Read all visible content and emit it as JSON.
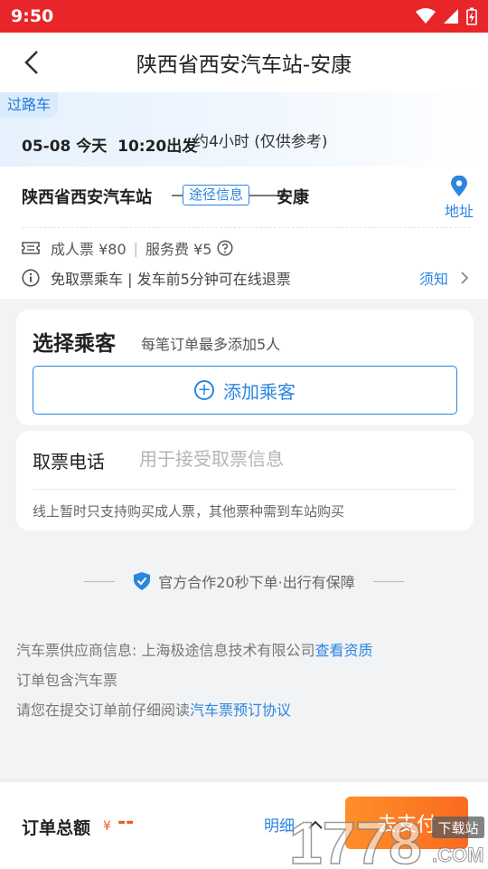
{
  "status_bar": {
    "time": "9:50"
  },
  "nav": {
    "title": "陕西省西安汽车站-安康"
  },
  "trip": {
    "tag": "过路车",
    "datetime": "05-08 今天  10:20出发",
    "duration": "约4小时 (仅供参考)",
    "from": "陕西省西安汽车站",
    "route_info": "途径信息",
    "to": "安康",
    "address_label": "地址",
    "adult_price": "成人票 ¥80",
    "service_fee": "服务费 ¥5",
    "notice": "免取票乘车 | 发车前5分钟可在线退票",
    "notice_more": "须知"
  },
  "passenger": {
    "title": "选择乘客",
    "subtitle": "每笔订单最多添加5人",
    "add_label": "添加乘客"
  },
  "phone": {
    "label": "取票电话",
    "placeholder": "用于接受取票信息",
    "note": "线上暂时只支持购买成人票，其他票种需到车站购买"
  },
  "guarantee": {
    "text": "官方合作20秒下单·出行有保障"
  },
  "info": {
    "supplier_prefix": "汽车票供应商信息: 上海极途信息技术有限公司",
    "supplier_link": "查看资质",
    "includes": "订单包含汽车票",
    "agreement_prefix": "请您在提交订单前仔细阅读",
    "agreement_link": "汽车票预订协议"
  },
  "footer": {
    "total_label": "订单总额",
    "currency": "¥",
    "total_value": "--",
    "detail_label": "明细",
    "pay_label": "去支付"
  },
  "watermark": {
    "text": "1778",
    "domain": "下载站",
    "suffix": ".COM"
  },
  "colors": {
    "status_bar": "#e8262a",
    "accent_blue": "#2a86e0",
    "price_orange": "#ef5a24",
    "pay_button": "#fb6a1f"
  }
}
